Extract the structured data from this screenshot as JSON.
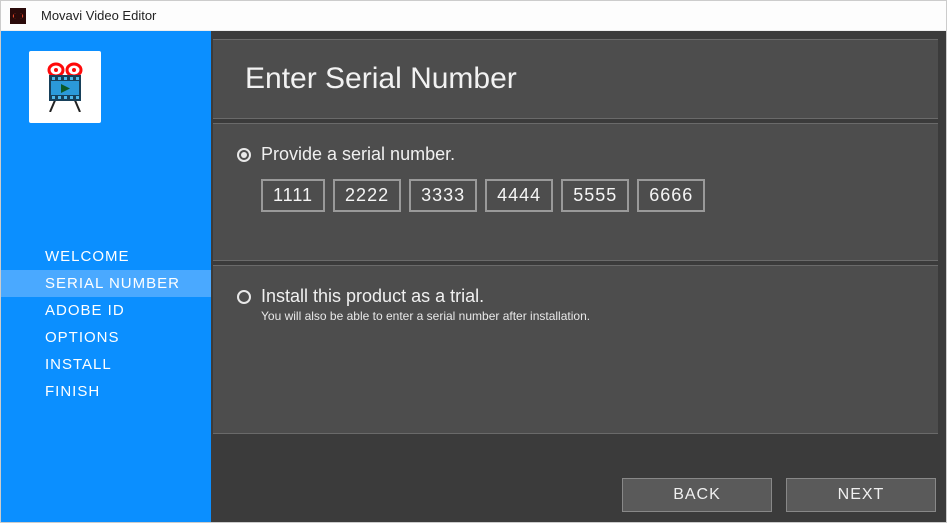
{
  "titlebar": {
    "app_name": "Movavi Video Editor"
  },
  "sidebar": {
    "items": [
      {
        "label": "WELCOME"
      },
      {
        "label": "SERIAL NUMBER"
      },
      {
        "label": "ADOBE ID"
      },
      {
        "label": "OPTIONS"
      },
      {
        "label": "INSTALL"
      },
      {
        "label": "FINISH"
      }
    ],
    "active_index": 1
  },
  "header": {
    "title": "Enter Serial Number"
  },
  "serial_option": {
    "label": "Provide a serial number.",
    "selected": true,
    "fields": [
      "1111",
      "2222",
      "3333",
      "4444",
      "5555",
      "6666"
    ]
  },
  "trial_option": {
    "label": "Install this product as a trial.",
    "hint": "You will also be able to enter a serial number after installation.",
    "selected": false
  },
  "buttons": {
    "back": "BACK",
    "next": "NEXT"
  }
}
